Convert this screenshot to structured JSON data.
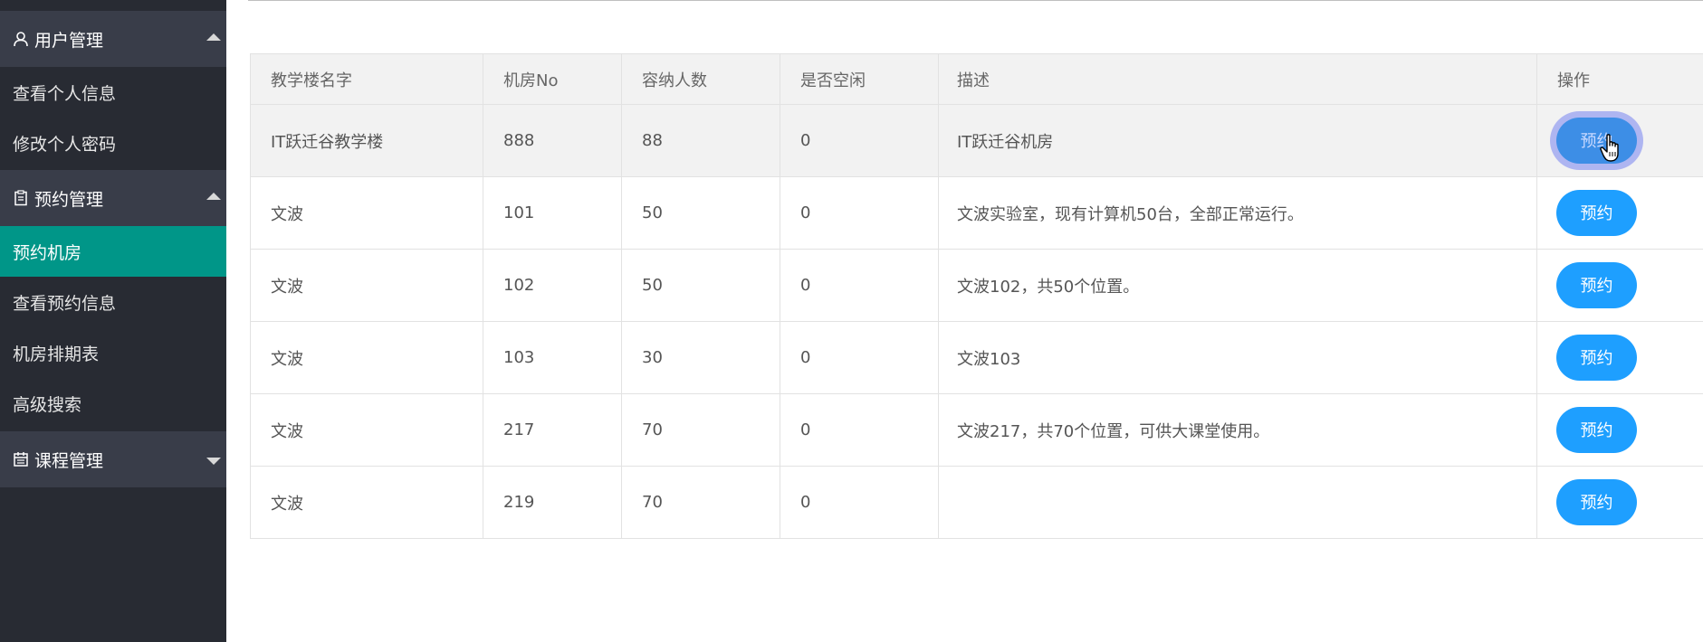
{
  "sidebar": {
    "groups": [
      {
        "label": "用户管理",
        "icon": "user-icon",
        "expanded": true
      },
      {
        "label": "预约管理",
        "icon": "clipboard-icon",
        "expanded": true
      },
      {
        "label": "课程管理",
        "icon": "calendar-icon",
        "expanded": false
      }
    ],
    "user_items": [
      "查看个人信息",
      "修改个人密码"
    ],
    "booking_items": [
      "预约机房",
      "查看预约信息",
      "机房排期表",
      "高级搜索"
    ],
    "active_item": "预约机房"
  },
  "table": {
    "columns": [
      "教学楼名字",
      "机房No",
      "容纳人数",
      "是否空闲",
      "描述",
      "操作"
    ],
    "rows": [
      {
        "building": "IT跃迁谷教学楼",
        "room_no": "888",
        "capacity": "88",
        "free": "0",
        "desc": "IT跃迁谷机房",
        "action": "预约"
      },
      {
        "building": "文波",
        "room_no": "101",
        "capacity": "50",
        "free": "0",
        "desc": "文波实验室，现有计算机50台，全部正常运行。",
        "action": "预约"
      },
      {
        "building": "文波",
        "room_no": "102",
        "capacity": "50",
        "free": "0",
        "desc": "文波102，共50个位置。",
        "action": "预约"
      },
      {
        "building": "文波",
        "room_no": "103",
        "capacity": "30",
        "free": "0",
        "desc": "文波103",
        "action": "预约"
      },
      {
        "building": "文波",
        "room_no": "217",
        "capacity": "70",
        "free": "0",
        "desc": "文波217，共70个位置，可供大课堂使用。",
        "action": "预约"
      },
      {
        "building": "文波",
        "room_no": "219",
        "capacity": "70",
        "free": "0",
        "desc": "",
        "action": "预约"
      }
    ]
  },
  "colors": {
    "sidebar_bg": "#282b33",
    "group_header_bg": "#393d49",
    "active_item_bg": "#009688",
    "button_bg": "#1e9fff",
    "header_row_bg": "#f2f2f2"
  }
}
